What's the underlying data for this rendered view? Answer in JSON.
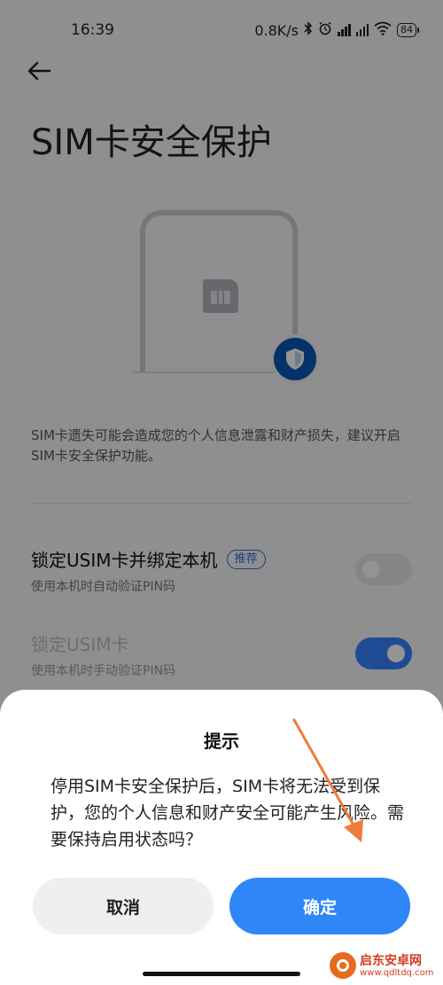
{
  "status_bar": {
    "time": "16:39",
    "network_speed": "0.8K/s",
    "battery": "84",
    "icons": [
      "bluetooth-icon",
      "alarm-icon",
      "signal-hd-icon",
      "signal-hd-icon",
      "wifi-icon",
      "battery-icon"
    ]
  },
  "header": {
    "back_icon": "arrow-left-icon",
    "title": "SIM卡安全保护"
  },
  "illustration": {
    "icons": [
      "phone-frame",
      "sim-card-icon",
      "shield-icon"
    ],
    "accent_color": "#0a57b6"
  },
  "description": "SIM卡遗失可能会造成您的个人信息泄露和财产损失，建议开启SIM卡安全保护功能。",
  "options": [
    {
      "title": "锁定USIM卡并绑定本机",
      "badge": "推荐",
      "subtitle": "使用本机时自动验证PIN码",
      "toggle_on": false,
      "enabled": true
    },
    {
      "title": "锁定USIM卡",
      "subtitle": "使用本机时手动验证PIN码",
      "toggle_on": true,
      "enabled": false
    }
  ],
  "dialog": {
    "title": "提示",
    "message": "停用SIM卡安全保护后，SIM卡将无法受到保护，您的个人信息和财产安全可能产生风险。需要保持启用状态吗？",
    "cancel_label": "取消",
    "confirm_label": "确定",
    "confirm_color": "#2e86f7"
  },
  "annotation": {
    "arrow_color": "#f07b3a"
  },
  "watermark": {
    "name": "启东安卓网",
    "url": "www.qdltdq.com"
  }
}
